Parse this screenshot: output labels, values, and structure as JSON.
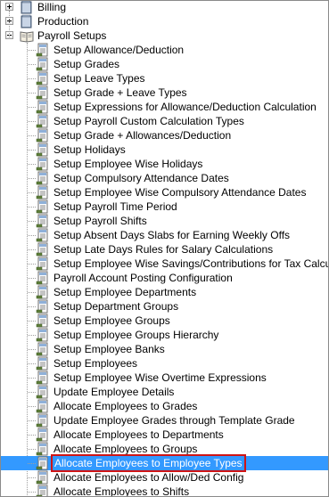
{
  "tree": {
    "top_nodes": [
      {
        "label": "Billing",
        "state": "collapsed",
        "icon": "folder-icon"
      },
      {
        "label": "Production",
        "state": "collapsed",
        "icon": "folder-icon"
      },
      {
        "label": "Payroll Setups",
        "state": "expanded",
        "icon": "open-book-icon"
      }
    ],
    "payroll_items": [
      "Setup Allowance/Deduction",
      "Setup Grades",
      "Setup Leave Types",
      "Setup Grade + Leave Types",
      "Setup Expressions for Allowance/Deduction Calculation",
      "Setup Payroll Custom Calculation Types",
      "Setup Grade + Allowances/Deduction",
      "Setup Holidays",
      "Setup Employee Wise Holidays",
      "Setup Compulsory Attendance Dates",
      "Setup Employee Wise Compulsory Attendance Dates",
      "Setup Payroll Time Period",
      "Setup Payroll Shifts",
      "Setup Absent Days Slabs for Earning Weekly Offs",
      "Setup Late Days Rules for Salary Calculations",
      "Setup Employee Wise Savings/Contributions for Tax Calculation",
      "Payroll Account Posting Configuration",
      "Setup Employee Departments",
      "Setup Department Groups",
      "Setup Employee Groups",
      "Setup Employee Groups Hierarchy",
      "Setup Employee Banks",
      "Setup Employees",
      "Setup Employee Wise Overtime Expressions",
      "Update Employee Details",
      "Allocate Employees to Grades",
      "Update Employee Grades through Template Grade",
      "Allocate Employees to Departments",
      "Allocate Employees to Groups",
      "Allocate Employees to Employee Types",
      "Allocate Employees to Allow/Ded Config",
      "Allocate Employees to Shifts"
    ],
    "selected_item": "Allocate Employees to Employee Types",
    "item_icon": "document-page-icon",
    "colors": {
      "selection": "#3399ff",
      "highlight_border": "#d01414"
    }
  }
}
